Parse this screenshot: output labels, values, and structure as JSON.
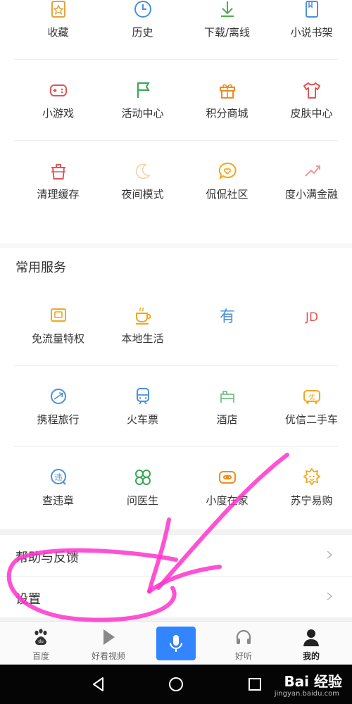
{
  "grid1": [
    [
      {
        "label": "收藏",
        "icon": "bookmark-star-icon",
        "color": "#e6a23c"
      },
      {
        "label": "历史",
        "icon": "clock-icon",
        "color": "#4a90d9"
      },
      {
        "label": "下载/离线",
        "icon": "download-icon",
        "color": "#4caf50"
      },
      {
        "label": "小说书架",
        "icon": "book-icon",
        "color": "#4a90d9"
      }
    ],
    [
      {
        "label": "小游戏",
        "icon": "gamepad-icon",
        "color": "#e05555"
      },
      {
        "label": "活动中心",
        "icon": "flag-icon",
        "color": "#3aa655"
      },
      {
        "label": "积分商城",
        "icon": "gift-icon",
        "color": "#f08c1e"
      },
      {
        "label": "皮肤中心",
        "icon": "shirt-icon",
        "color": "#e05555"
      }
    ],
    [
      {
        "label": "清理缓存",
        "icon": "trash-icon",
        "color": "#e05555"
      },
      {
        "label": "夜间模式",
        "icon": "moon-icon",
        "color": "#e6a23c"
      },
      {
        "label": "侃侃社区",
        "icon": "chat-heart-icon",
        "color": "#f0a81e"
      },
      {
        "label": "度小满金融",
        "icon": "finance-icon",
        "color": "#e05555"
      }
    ]
  ],
  "section_title": "常用服务",
  "grid2": [
    [
      {
        "label": "免流量特权",
        "icon": "data-card-icon",
        "color": "#f0a81e"
      },
      {
        "label": "本地生活",
        "icon": "coffee-cup-icon",
        "color": "#f0a81e"
      },
      {
        "label": "有",
        "icon": "you-text-icon",
        "color": "#4a90d9"
      },
      {
        "label": "JD",
        "icon": "jd-icon",
        "color": "#e05555"
      }
    ],
    [
      {
        "label": "携程旅行",
        "icon": "globe-plane-icon",
        "color": "#4a90d9"
      },
      {
        "label": "火车票",
        "icon": "train-icon",
        "color": "#4a90d9"
      },
      {
        "label": "酒店",
        "icon": "hotel-icon",
        "color": "#3aa655"
      },
      {
        "label": "优信二手车",
        "icon": "youxin-car-icon",
        "color": "#f0a81e"
      }
    ],
    [
      {
        "label": "查违章",
        "icon": "violation-icon",
        "color": "#4a90d9"
      },
      {
        "label": "问医生",
        "icon": "clover-icon",
        "color": "#3aa655"
      },
      {
        "label": "小度在家",
        "icon": "smart-speaker-icon",
        "color": "#f08c1e"
      },
      {
        "label": "苏宁易购",
        "icon": "suning-icon",
        "color": "#f0a81e"
      }
    ]
  ],
  "menu": {
    "help": "帮助与反馈",
    "settings": "设置"
  },
  "tabs": [
    {
      "label": "百度",
      "icon": "baidu-paw-icon"
    },
    {
      "label": "好看视频",
      "icon": "play-icon"
    },
    {
      "label": "",
      "icon": "microphone-icon"
    },
    {
      "label": "好听",
      "icon": "headphones-icon"
    },
    {
      "label": "我的",
      "icon": "profile-icon"
    }
  ],
  "watermark": {
    "brand": "Bai 经验",
    "url": "jingyan.baidu.com"
  },
  "colors": {
    "accent": "#3385ff",
    "annotation": "#ff33cc"
  }
}
